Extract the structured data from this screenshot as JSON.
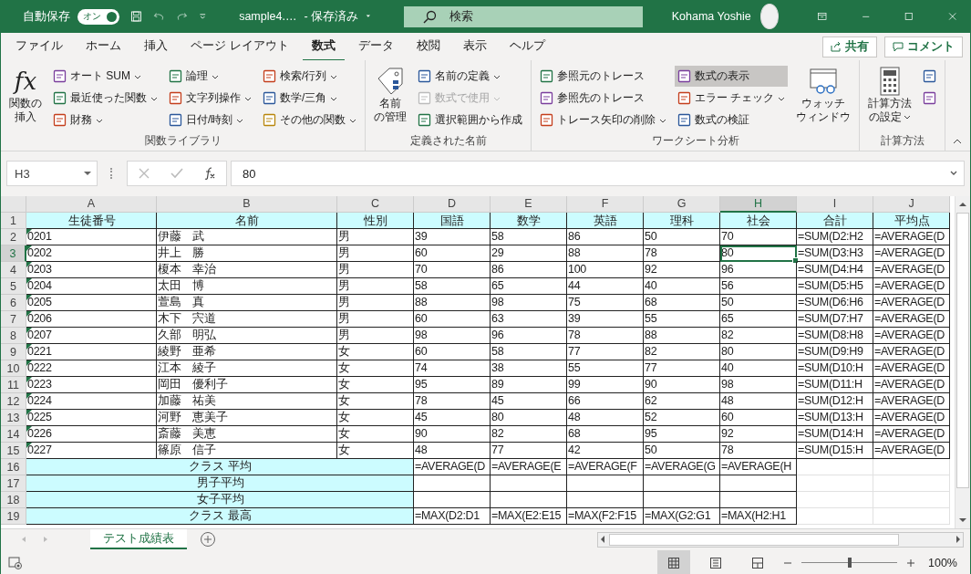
{
  "title_bar": {
    "autosave": {
      "label": "自動保存",
      "toggle_text": "オン",
      "on": true
    },
    "file_name": "sample4.…",
    "save_state": "- 保存済み",
    "search": {
      "placeholder": "検索"
    },
    "user": "Kohama Yoshie"
  },
  "tabs": [
    {
      "label": "ファイル",
      "selected": false
    },
    {
      "label": "ホーム",
      "selected": false
    },
    {
      "label": "挿入",
      "selected": false
    },
    {
      "label": "ページ レイアウト",
      "selected": false
    },
    {
      "label": "数式",
      "selected": true
    },
    {
      "label": "データ",
      "selected": false
    },
    {
      "label": "校閲",
      "selected": false
    },
    {
      "label": "表示",
      "selected": false
    },
    {
      "label": "ヘルプ",
      "selected": false
    }
  ],
  "share_button": "共有",
  "comment_button": "コメント",
  "ribbon": {
    "groups": [
      {
        "label": "関数ライブラリ",
        "items": [
          {
            "kind": "large",
            "icon_text": "fx",
            "lines": [
              "関数の",
              "挿入"
            ]
          },
          {
            "kind": "stack",
            "items": [
              {
                "label": "オート SUM",
                "dropdown": true
              },
              {
                "label": "最近使った関数",
                "dropdown": true
              },
              {
                "label": "財務",
                "dropdown": true
              }
            ]
          },
          {
            "kind": "stack",
            "items": [
              {
                "label": "論理",
                "dropdown": true
              },
              {
                "label": "文字列操作",
                "dropdown": true
              },
              {
                "label": "日付/時刻",
                "dropdown": true
              }
            ]
          },
          {
            "kind": "stack",
            "items": [
              {
                "label": "検索/行列",
                "dropdown": true
              },
              {
                "label": "数学/三角",
                "dropdown": true
              },
              {
                "label": "その他の関数",
                "dropdown": true
              }
            ]
          }
        ]
      },
      {
        "label": "定義された名前",
        "items": [
          {
            "kind": "large",
            "lines": [
              "名前",
              "の管理"
            ]
          },
          {
            "kind": "stack",
            "items": [
              {
                "label": "名前の定義",
                "dropdown": true
              },
              {
                "label": "数式で使用",
                "dropdown": true,
                "disabled": true
              },
              {
                "label": "選択範囲から作成",
                "dropdown": false
              }
            ]
          }
        ]
      },
      {
        "label": "ワークシート分析",
        "items": [
          {
            "kind": "stack",
            "items": [
              {
                "label": "参照元のトレース",
                "dropdown": false
              },
              {
                "label": "参照先のトレース",
                "dropdown": false
              },
              {
                "label": "トレース矢印の削除",
                "dropdown": true
              }
            ]
          },
          {
            "kind": "stack",
            "items": [
              {
                "label": "数式の表示",
                "dropdown": false,
                "pressed": true
              },
              {
                "label": "エラー チェック",
                "dropdown": true
              },
              {
                "label": "数式の検証",
                "dropdown": false
              }
            ]
          },
          {
            "kind": "large",
            "lines": [
              "ウォッチ",
              "ウィンドウ"
            ]
          }
        ]
      },
      {
        "label": "計算方法",
        "items": [
          {
            "kind": "large",
            "lines": [
              "計算方法",
              "の設定"
            ],
            "dropdown": true
          },
          {
            "kind": "stack",
            "items": [
              {
                "dropdown": false
              },
              {
                "dropdown": false
              }
            ]
          }
        ]
      }
    ]
  },
  "formula_bar": {
    "name_box": "H3",
    "formula": "80"
  },
  "columns": [
    {
      "letter": "A",
      "selected": false
    },
    {
      "letter": "B",
      "selected": false
    },
    {
      "letter": "C",
      "selected": false
    },
    {
      "letter": "D",
      "selected": false
    },
    {
      "letter": "E",
      "selected": false
    },
    {
      "letter": "F",
      "selected": false
    },
    {
      "letter": "G",
      "selected": false
    },
    {
      "letter": "H",
      "selected": true
    },
    {
      "letter": "I",
      "selected": false
    },
    {
      "letter": "J",
      "selected": false
    }
  ],
  "rows": [
    {
      "kind": "header",
      "num": "1",
      "selected": false,
      "cells": [
        "生徒番号",
        "名前",
        "性別",
        "国語",
        "数学",
        "英語",
        "理科",
        "社会",
        "合計",
        "平均点"
      ]
    },
    {
      "kind": "data",
      "num": "2",
      "selected": false,
      "flag": true,
      "cells": [
        "0201",
        "伊藤　武",
        "男",
        "39",
        "58",
        "86",
        "50",
        "70",
        "=SUM(D2:H2",
        "=AVERAGE(D"
      ]
    },
    {
      "kind": "data",
      "num": "3",
      "selected": true,
      "flag": true,
      "cells": [
        "0202",
        "井上　勝",
        "男",
        "60",
        "29",
        "88",
        "78",
        "80",
        "=SUM(D3:H3",
        "=AVERAGE(D"
      ]
    },
    {
      "kind": "data",
      "num": "4",
      "selected": false,
      "flag": true,
      "cells": [
        "0203",
        "榎本　幸治",
        "男",
        "70",
        "86",
        "100",
        "92",
        "96",
        "=SUM(D4:H4",
        "=AVERAGE(D"
      ]
    },
    {
      "kind": "data",
      "num": "5",
      "selected": false,
      "flag": true,
      "cells": [
        "0204",
        "太田　博",
        "男",
        "58",
        "65",
        "44",
        "40",
        "56",
        "=SUM(D5:H5",
        "=AVERAGE(D"
      ]
    },
    {
      "kind": "data",
      "num": "6",
      "selected": false,
      "flag": true,
      "cells": [
        "0205",
        "萱島　真",
        "男",
        "88",
        "98",
        "75",
        "68",
        "50",
        "=SUM(D6:H6",
        "=AVERAGE(D"
      ]
    },
    {
      "kind": "data",
      "num": "7",
      "selected": false,
      "flag": true,
      "cells": [
        "0206",
        "木下　宍道",
        "男",
        "60",
        "63",
        "39",
        "55",
        "65",
        "=SUM(D7:H7",
        "=AVERAGE(D"
      ]
    },
    {
      "kind": "data",
      "num": "8",
      "selected": false,
      "flag": true,
      "cells": [
        "0207",
        "久部　明弘",
        "男",
        "98",
        "96",
        "78",
        "88",
        "82",
        "=SUM(D8:H8",
        "=AVERAGE(D"
      ]
    },
    {
      "kind": "data",
      "num": "9",
      "selected": false,
      "flag": true,
      "cells": [
        "0221",
        "綾野　亜希",
        "女",
        "60",
        "58",
        "77",
        "82",
        "80",
        "=SUM(D9:H9",
        "=AVERAGE(D"
      ]
    },
    {
      "kind": "data",
      "num": "10",
      "selected": false,
      "flag": true,
      "cells": [
        "0222",
        "江本　綾子",
        "女",
        "74",
        "38",
        "55",
        "77",
        "40",
        "=SUM(D10:H",
        "=AVERAGE(D"
      ]
    },
    {
      "kind": "data",
      "num": "11",
      "selected": false,
      "flag": true,
      "cells": [
        "0223",
        "岡田　優利子",
        "女",
        "95",
        "89",
        "99",
        "90",
        "98",
        "=SUM(D11:H",
        "=AVERAGE(D"
      ]
    },
    {
      "kind": "data",
      "num": "12",
      "selected": false,
      "flag": true,
      "cells": [
        "0224",
        "加藤　祐美",
        "女",
        "78",
        "45",
        "66",
        "62",
        "48",
        "=SUM(D12:H",
        "=AVERAGE(D"
      ]
    },
    {
      "kind": "data",
      "num": "13",
      "selected": false,
      "flag": true,
      "cells": [
        "0225",
        "河野　恵美子",
        "女",
        "45",
        "80",
        "48",
        "52",
        "60",
        "=SUM(D13:H",
        "=AVERAGE(D"
      ]
    },
    {
      "kind": "data",
      "num": "14",
      "selected": false,
      "flag": true,
      "cells": [
        "0226",
        "斎藤　美恵",
        "女",
        "90",
        "82",
        "68",
        "95",
        "92",
        "=SUM(D14:H",
        "=AVERAGE(D"
      ]
    },
    {
      "kind": "data",
      "num": "15",
      "selected": false,
      "flag": true,
      "cells": [
        "0227",
        "篠原　信子",
        "女",
        "48",
        "77",
        "42",
        "50",
        "78",
        "=SUM(D15:H",
        "=AVERAGE(D"
      ]
    },
    {
      "kind": "summary",
      "num": "16",
      "selected": false,
      "label": "クラス 平均",
      "cells": [
        "=AVERAGE(D",
        "=AVERAGE(E",
        "=AVERAGE(F",
        "=AVERAGE(G",
        "=AVERAGE(H"
      ]
    },
    {
      "kind": "summary",
      "num": "17",
      "selected": false,
      "label": "男子平均",
      "cells": []
    },
    {
      "kind": "summary",
      "num": "18",
      "selected": false,
      "label": "女子平均",
      "cells": []
    },
    {
      "kind": "summary",
      "num": "19",
      "selected": false,
      "label": "クラス 最高",
      "cells": [
        "=MAX(D2:D1",
        "=MAX(E2:E15",
        "=MAX(F2:F15",
        "=MAX(G2:G1",
        "=MAX(H2:H1"
      ]
    }
  ],
  "sheet_tabs": [
    {
      "label": "テスト成績表",
      "selected": true
    }
  ],
  "status_bar": {
    "views": [
      {
        "selected": true
      },
      {
        "selected": false
      },
      {
        "selected": false
      }
    ],
    "zoom": {
      "level": 0.5,
      "reading": "100%"
    }
  }
}
